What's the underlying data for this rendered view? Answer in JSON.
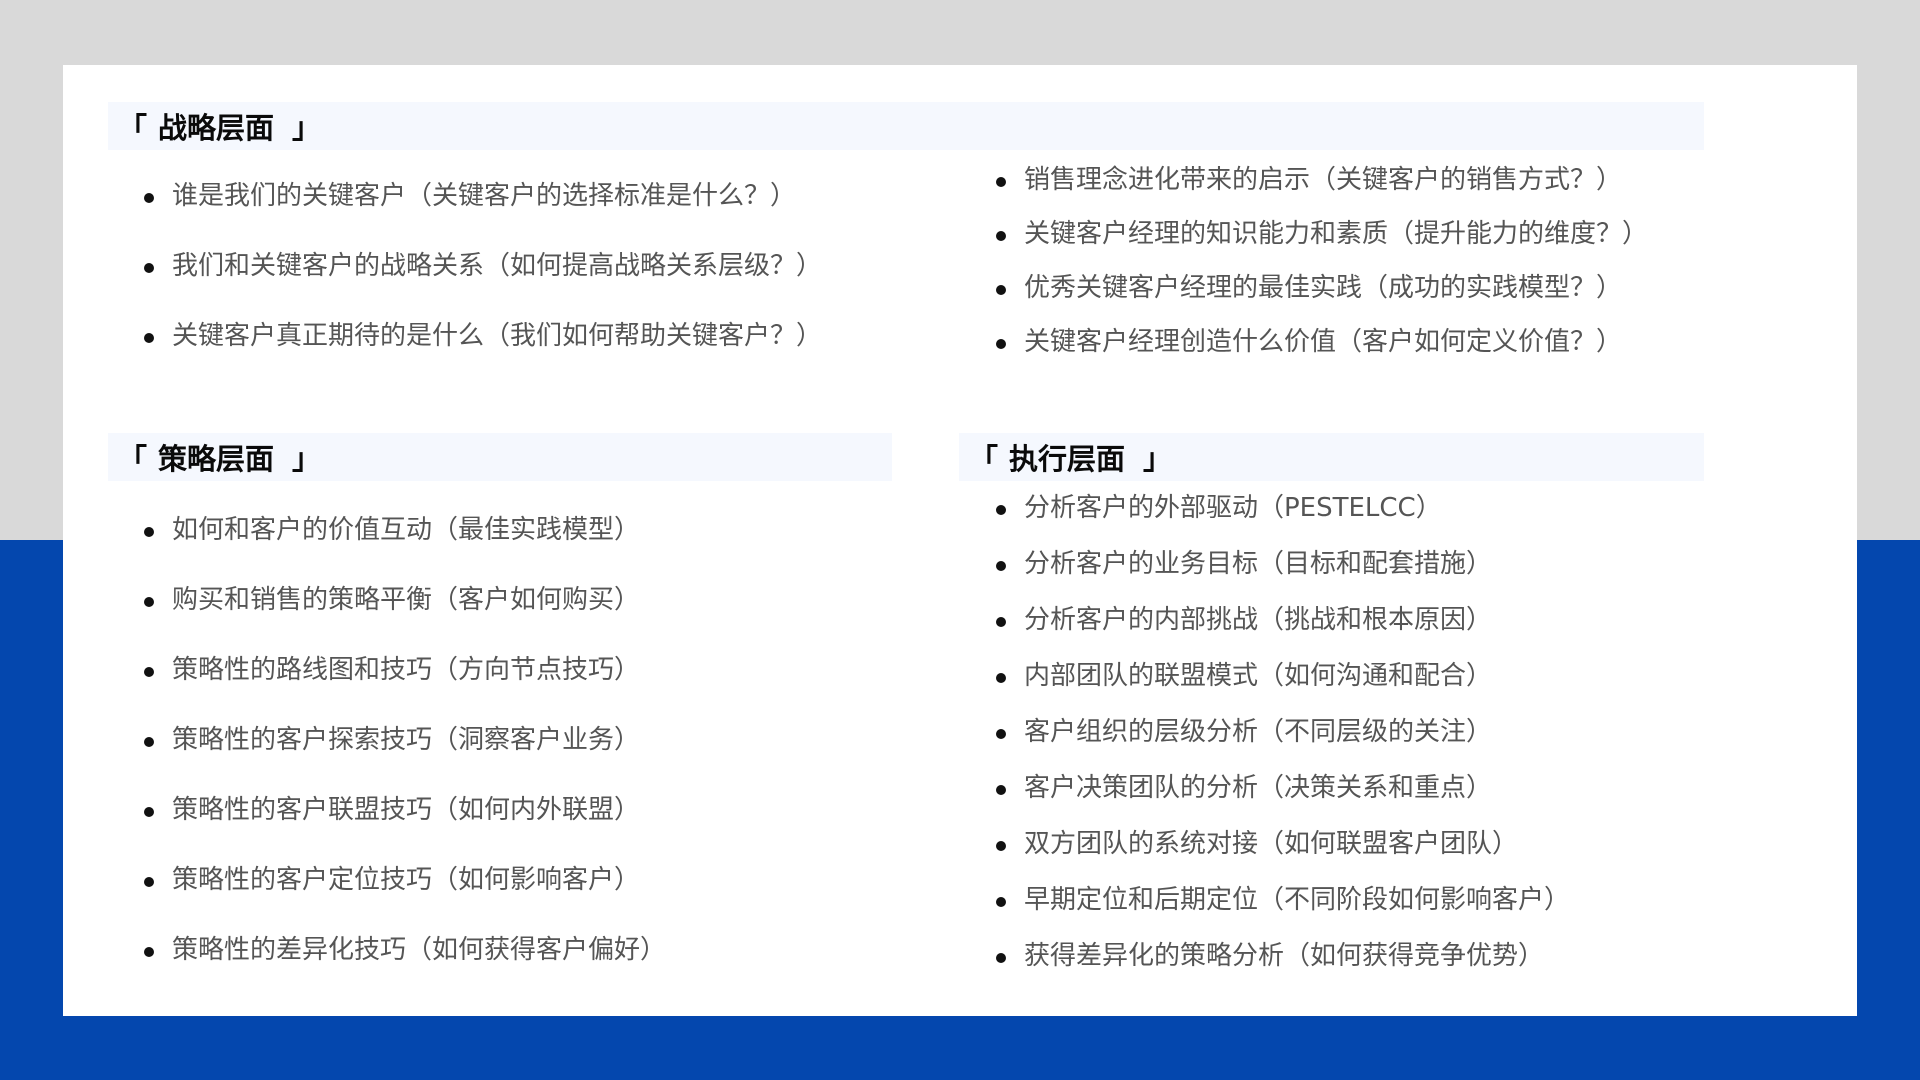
{
  "sections": {
    "strategy": {
      "bracket_open": "「",
      "title": "战略层面",
      "bracket_close": "」",
      "items_left": [
        "谁是我们的关键客户（关键客户的选择标准是什么？）",
        "我们和关键客户的战略关系（如何提高战略关系层级？）",
        "关键客户真正期待的是什么（我们如何帮助关键客户？）"
      ],
      "items_right": [
        "销售理念进化带来的启示（关键客户的销售方式？）",
        "关键客户经理的知识能力和素质（提升能力的维度？）",
        "优秀关键客户经理的最佳实践（成功的实践模型？）",
        "关键客户经理创造什么价值（客户如何定义价值？）"
      ]
    },
    "tactics": {
      "bracket_open": "「",
      "title": "策略层面",
      "bracket_close": "」",
      "items": [
        "如何和客户的价值互动（最佳实践模型）",
        "购买和销售的策略平衡（客户如何购买）",
        "策略性的路线图和技巧（方向节点技巧）",
        "策略性的客户探索技巧（洞察客户业务）",
        "策略性的客户联盟技巧（如何内外联盟）",
        "策略性的客户定位技巧（如何影响客户）",
        "策略性的差异化技巧（如何获得客户偏好）"
      ]
    },
    "execution": {
      "bracket_open": "「",
      "title": "执行层面",
      "bracket_close": "」",
      "items": [
        "分析客户的外部驱动（PESTELCC）",
        "分析客户的业务目标（目标和配套措施）",
        "分析客户的内部挑战（挑战和根本原因）",
        "内部团队的联盟模式（如何沟通和配合）",
        "客户组织的层级分析（不同层级的关注）",
        "客户决策团队的分析（决策关系和重点）",
        "双方团队的系统对接（如何联盟客户团队）",
        "早期定位和后期定位（不同阶段如何影响客户）",
        "获得差异化的策略分析（如何获得竞争优势）"
      ]
    }
  },
  "colors": {
    "background_top": "#d9d9d9",
    "background_bottom": "#0447ae",
    "card": "#ffffff",
    "header_band": "#f5f8fe",
    "text": "#555555",
    "heading": "#0a0a0a"
  }
}
